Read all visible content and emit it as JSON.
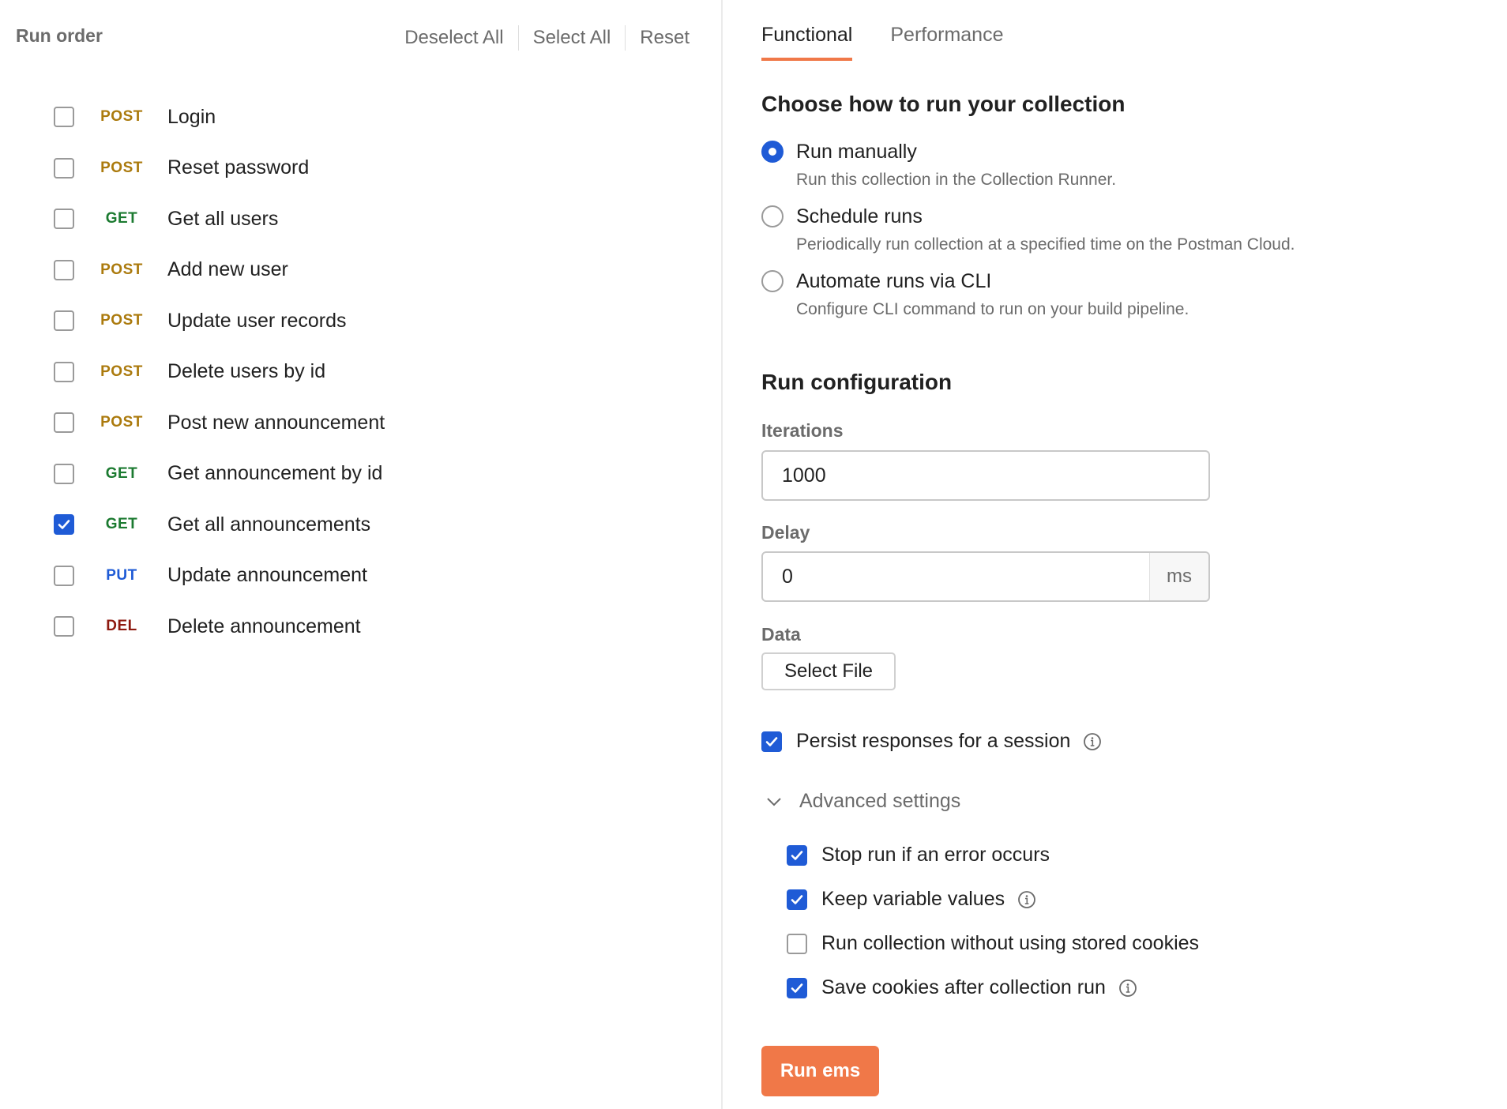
{
  "run_order": {
    "title": "Run order",
    "actions": {
      "deselect_all": "Deselect All",
      "select_all": "Select All",
      "reset": "Reset"
    },
    "requests": [
      {
        "method": "POST",
        "name": "Login",
        "checked": false
      },
      {
        "method": "POST",
        "name": "Reset password",
        "checked": false
      },
      {
        "method": "GET",
        "name": "Get all users",
        "checked": false
      },
      {
        "method": "POST",
        "name": "Add new user",
        "checked": false
      },
      {
        "method": "POST",
        "name": "Update user records",
        "checked": false
      },
      {
        "method": "POST",
        "name": "Delete users by id",
        "checked": false
      },
      {
        "method": "POST",
        "name": "Post new announcement",
        "checked": false
      },
      {
        "method": "GET",
        "name": "Get announcement by id",
        "checked": false
      },
      {
        "method": "GET",
        "name": "Get all announcements",
        "checked": true
      },
      {
        "method": "PUT",
        "name": "Update announcement",
        "checked": false
      },
      {
        "method": "DEL",
        "name": "Delete announcement",
        "checked": false
      }
    ]
  },
  "tabs": [
    {
      "label": "Functional",
      "active": true
    },
    {
      "label": "Performance",
      "active": false
    }
  ],
  "run_mode": {
    "title": "Choose how to run your collection",
    "options": [
      {
        "label": "Run manually",
        "description": "Run this collection in the Collection Runner.",
        "selected": true
      },
      {
        "label": "Schedule runs",
        "description": "Periodically run collection at a specified time on the Postman Cloud.",
        "selected": false
      },
      {
        "label": "Automate runs via CLI",
        "description": "Configure CLI command to run on your build pipeline.",
        "selected": false
      }
    ]
  },
  "run_config": {
    "title": "Run configuration",
    "iterations": {
      "label": "Iterations",
      "value": "1000"
    },
    "delay": {
      "label": "Delay",
      "value": "0",
      "unit": "ms"
    },
    "data": {
      "label": "Data",
      "button": "Select File"
    },
    "persist_responses": {
      "label": "Persist responses for a session",
      "checked": true
    },
    "advanced": {
      "label": "Advanced settings",
      "expanded": true,
      "options": [
        {
          "label": "Stop run if an error occurs",
          "checked": true,
          "info": false
        },
        {
          "label": "Keep variable values",
          "checked": true,
          "info": true
        },
        {
          "label": "Run collection without using stored cookies",
          "checked": false,
          "info": false
        },
        {
          "label": "Save cookies after collection run",
          "checked": true,
          "info": true
        }
      ]
    },
    "run_button": "Run ems"
  },
  "colors": {
    "accent": "#f07848",
    "checkbox_blue": "#1f5bd6",
    "method_post": "#ab7a0d",
    "method_get": "#1b7a30",
    "method_put": "#1f5bd6",
    "method_del": "#8e1a10"
  },
  "icons": {
    "check": "checkmark-icon",
    "info": "info-icon",
    "chevron": "chevron-down-icon"
  }
}
